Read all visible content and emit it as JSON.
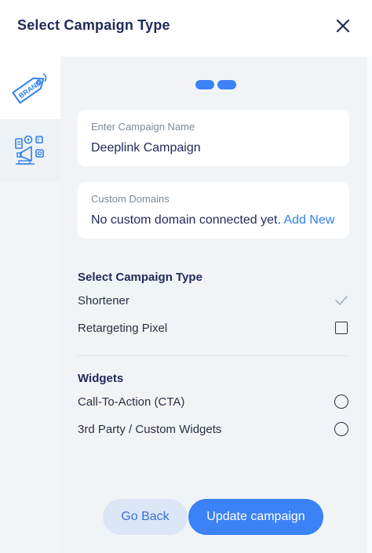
{
  "header": {
    "title": "Select Campaign Type",
    "close_icon": "close-icon"
  },
  "rail": {
    "items": [
      {
        "icon": "brand-tag-icon"
      },
      {
        "icon": "marketing-widgets-icon"
      }
    ]
  },
  "stepper": {
    "steps": 2
  },
  "campaign_name": {
    "label": "Enter Campaign Name",
    "value": "Deeplink Campaign"
  },
  "custom_domains": {
    "label": "Custom Domains",
    "text": "No custom domain connected yet.",
    "link": "Add New"
  },
  "campaign_type": {
    "title": "Select Campaign Type",
    "options": [
      {
        "label": "Shortener",
        "checked": true
      },
      {
        "label": "Retargeting Pixel",
        "checked": false
      }
    ]
  },
  "widgets": {
    "title": "Widgets",
    "options": [
      {
        "label": "Call-To-Action (CTA)",
        "selected": false
      },
      {
        "label": "3rd Party / Custom Widgets",
        "selected": false
      }
    ]
  },
  "actions": {
    "back": "Go Back",
    "update": "Update campaign"
  },
  "colors": {
    "accent": "#3b82f6",
    "title": "#1f2a5a",
    "panel": "#f1f4f6"
  }
}
